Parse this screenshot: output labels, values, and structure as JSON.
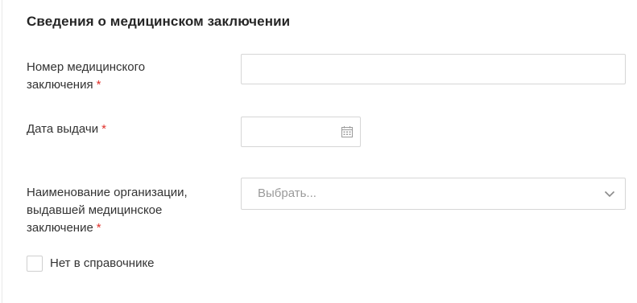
{
  "section": {
    "title": "Сведения о медицинском заключении"
  },
  "fields": {
    "number": {
      "label_line1": "Номер медицинского",
      "label_line2": "заключения",
      "required_mark": "*",
      "value": ""
    },
    "date": {
      "label": "Дата выдачи",
      "required_mark": "*",
      "value": "",
      "icon": "calendar-icon"
    },
    "organization": {
      "label_line1": "Наименование организации,",
      "label_line2": "выдавшей медицинское",
      "label_line3": "заключение",
      "required_mark": "*",
      "placeholder": "Выбрать...",
      "icon": "chevron-down-icon"
    }
  },
  "not_in_directory": {
    "label": "Нет в справочнике",
    "checked": false
  },
  "colors": {
    "required": "#e0302a",
    "border": "#d6d6d6",
    "placeholder": "#9a9a9a"
  }
}
